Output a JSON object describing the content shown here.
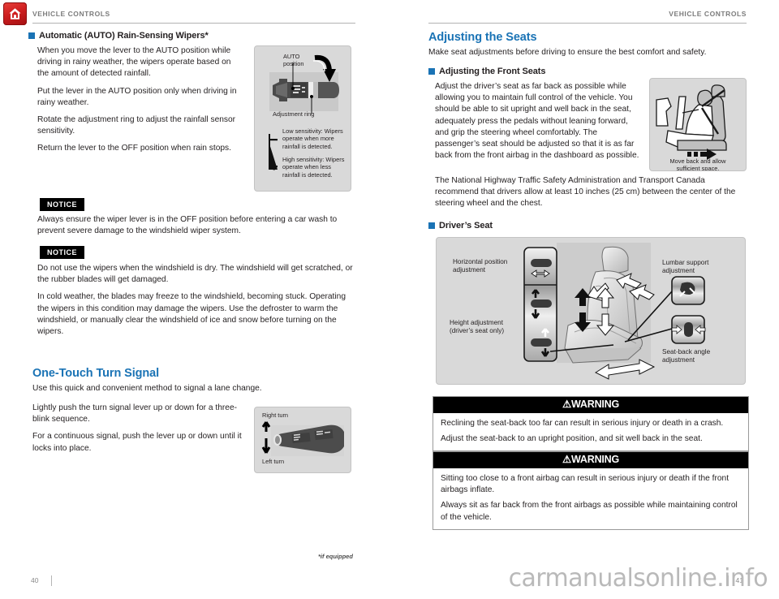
{
  "document": {
    "running_head_left": "VEHICLE CONTROLS",
    "running_head_right": "VEHICLE CONTROLS",
    "footnote": "*if equipped",
    "watermark": "carmanualsonline.info",
    "page_left": "40",
    "page_right": "41",
    "accent_blue": "#1a73b5",
    "logo_red": "#cf1f20",
    "logo_icon": "home-icon"
  },
  "left_page": {
    "wipers": {
      "heading": "Automatic (AUTO) Rain-Sensing Wipers*",
      "paragraphs": [
        "When you move the lever to the AUTO position while driving in rainy weather, the wipers operate based on the amount of detected rainfall.",
        "Put the lever in the AUTO position only when driving in rainy weather.",
        "Rotate the adjustment ring to adjust the rainfall sensor sensitivity.",
        "Return the lever to the OFF position when rain stops."
      ],
      "figure": {
        "label_auto_position": "AUTO\nposition",
        "label_auto_position_line1": "AUTO",
        "label_auto_position_line2": "position",
        "label_adjustment_ring": "Adjustment ring",
        "scale_minus": "−",
        "scale_plus": "+",
        "low_sensitivity": "Low sensitivity: Wipers operate when more rainfall is detected.",
        "high_sensitivity": "High sensitivity: Wipers operate when less rainfall is detected."
      }
    },
    "notices": [
      {
        "tag": "NOTICE",
        "paragraphs": [
          "Always ensure the wiper lever is in the OFF position before entering a car wash to prevent severe damage to the windshield wiper system."
        ]
      },
      {
        "tag": "NOTICE",
        "paragraphs": [
          "Do not use the wipers when the windshield is dry. The windshield will get scratched, or the rubber blades will get damaged.",
          "In cold weather, the blades may freeze to the windshield, becoming stuck. Operating the wipers in this condition may damage the wipers. Use the defroster to warm the windshield, or manually clear the windshield of ice and snow before turning on the wipers."
        ]
      }
    ],
    "turn_signal": {
      "heading": "One-Touch Turn Signal",
      "intro": "Use this quick and convenient method to signal a lane change.",
      "paragraphs": [
        "Lightly push the turn signal lever up or down for a three-blink sequence.",
        "For a continuous signal, push the lever up or down until it locks into place."
      ],
      "figure": {
        "label_right_turn": "Right turn",
        "label_left_turn": "Left turn"
      }
    }
  },
  "right_page": {
    "seats": {
      "heading": "Adjusting the Seats",
      "intro": "Make seat adjustments before driving to ensure the best comfort and safety.",
      "front_seats": {
        "heading": "Adjusting the Front Seats",
        "paragraphs": [
          "Adjust the driver’s seat as far back as possible while allowing you to maintain full control of the vehicle. You should be able to sit upright and well back in the seat, adequately press the pedals without leaning forward, and grip the steering wheel comfortably. The passenger’s seat should be adjusted so that it is as far back from the front airbag in the dashboard as possible.",
          "The National Highway Traffic Safety Administration and Transport Canada recommend that drivers allow at least 10 inches (25 cm) between the center of the steering wheel and the chest."
        ],
        "figure": {
          "caption_line1": "Move back and allow",
          "caption_line2": "sufficient space."
        }
      },
      "drivers_seat": {
        "heading": "Driver’s Seat",
        "figure": {
          "label_horizontal_line1": "Horizontal position",
          "label_horizontal_line2": "adjustment",
          "label_height_line1": "Height adjustment",
          "label_height_line2": "(driver’s seat only)",
          "label_lumbar_line1": "Lumbar support",
          "label_lumbar_line2": "adjustment",
          "label_seatback_line1": "Seat-back angle",
          "label_seatback_line2": "adjustment"
        }
      },
      "warnings": [
        {
          "title": "WARNING",
          "paragraphs": [
            "Reclining the seat-back too far can result in serious injury or death in a crash.",
            "Adjust the seat-back to an upright position, and sit well back in the seat."
          ]
        },
        {
          "title": "WARNING",
          "paragraphs": [
            "Sitting too close to a front airbag can result in serious injury or death if the front airbags inflate.",
            "Always sit as far back from the front airbags as possible while maintaining control of the vehicle."
          ]
        }
      ]
    }
  }
}
